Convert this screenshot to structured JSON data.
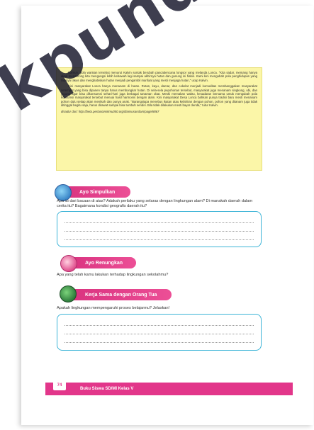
{
  "reading": {
    "paragraph_1": "Namun, pola warisan tersebut menurut Kalvin sontak berubah pascabencana longsor yang melanda Lonca. \"Kita sadar, memang hanya akan mendorong kita mengungsi lebih kebawah lagi sampai akhirnya hutan dan gunung ini habis. Kami kini mengubah pola penghidupan yang tadinya rakus dan menghabiskan hutan menjadi pengambil manfaat yang mesti menjaga hutan,\" ucap Kalvin.",
    "paragraph_2": "Kini masyarakat Lonca hanya menanam di hutan. Rotan, kayu, damar, dan cokelat menjadi komoditas membanggakan masyarakat setempat yang bisa dipanen tanpa harus membongkar hutan. Di sela-sela pepohonan tersebut, masyarakat juga menanam singkong, ubi, dan jagung agar bisa dikonsumsi sehari-hari juga berbagai tanaman obat. Meski memakan waktu, kesadaran bersama untuk mengubah pola konsumsi masyarakat tersebut menuai hasil harmonis dengan alam. Kini masyarakat Desa Lonca bahkan punya tradisi baru mesti menanam pohon dulu setiap akan menikah dan punya anak. \"Barangsiapa menebus ikatan atau kelahiran dengan pohon, pohon yang ditanam juga tidak ditinggal begitu saja, harus dirawat sampai bisa tumbuh sendiri. Bila tidak dilakukan mesti bayar denda,\" tutur Kalvin.",
    "source": "disadur dari: http://beta.pertanianskmu050.org/diansusandam/page/8867"
  },
  "sections": {
    "simpulkan": "Ayo Simpulkan",
    "renungkan": "Ayo Renungkan",
    "kerja_sama": "Kerja Sama dengan Orang Tua"
  },
  "questions": {
    "q1": "Apa isi dari bacaan di atas? Adakah perilaku yang selaras dengan lingkungan alam? Di manakah daerah dalam cerita itu? Bagaimana kondisi geografis daerah itu?",
    "q2": "Apa yang telah kamu lakukan terhadap lingkungan sekolahmu?",
    "q3": "Apakah lingkungan mempengaruhi proses belajarmu? Jelaskan!"
  },
  "footer": {
    "page_number": "74",
    "book_title": "Buku Siswa SD/MI Kelas V"
  },
  "watermark": "kpundo.lo",
  "colors": {
    "accent_pink": "#e2368a",
    "answer_border": "#3cb4d7",
    "reading_bg": "#fbf6a8"
  }
}
